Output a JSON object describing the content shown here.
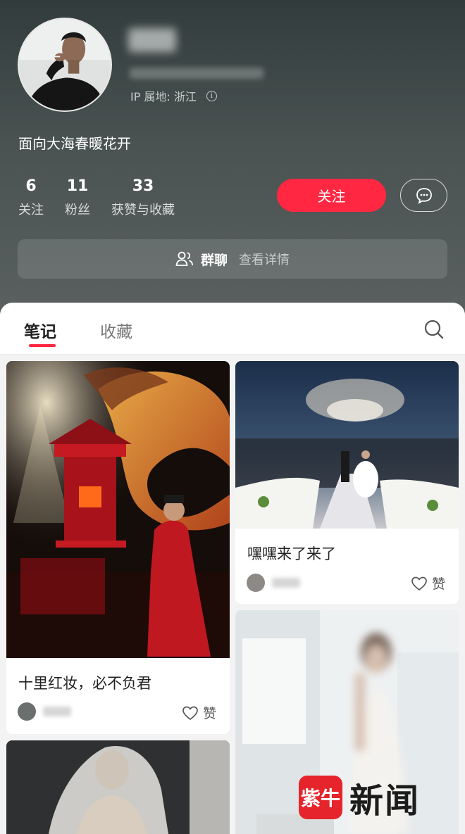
{
  "profile": {
    "ip_location": "IP 属地: 浙江",
    "bio": "面向大海春暖花开"
  },
  "stats": [
    {
      "count": "6",
      "label": "关注"
    },
    {
      "count": "11",
      "label": "粉丝"
    },
    {
      "count": "33",
      "label": "获赞与收藏"
    }
  ],
  "actions": {
    "follow_label": "关注",
    "message_icon": "chat-bubble-icon"
  },
  "group_chat": {
    "icon": "users-icon",
    "title": "群聊",
    "link": "查看详情"
  },
  "tabs": {
    "notes": "笔记",
    "favorites": "收藏",
    "search_icon": "search-icon"
  },
  "notes": [
    {
      "title": "十里红妆，必不负君",
      "like_label": "赞"
    },
    {
      "title": "嘿嘿来了来了",
      "like_label": "赞"
    }
  ],
  "watermark": {
    "badge": "紫牛",
    "text": "新闻"
  },
  "colors": {
    "accent": "#ff2741",
    "header_bg": "#4a5352"
  }
}
